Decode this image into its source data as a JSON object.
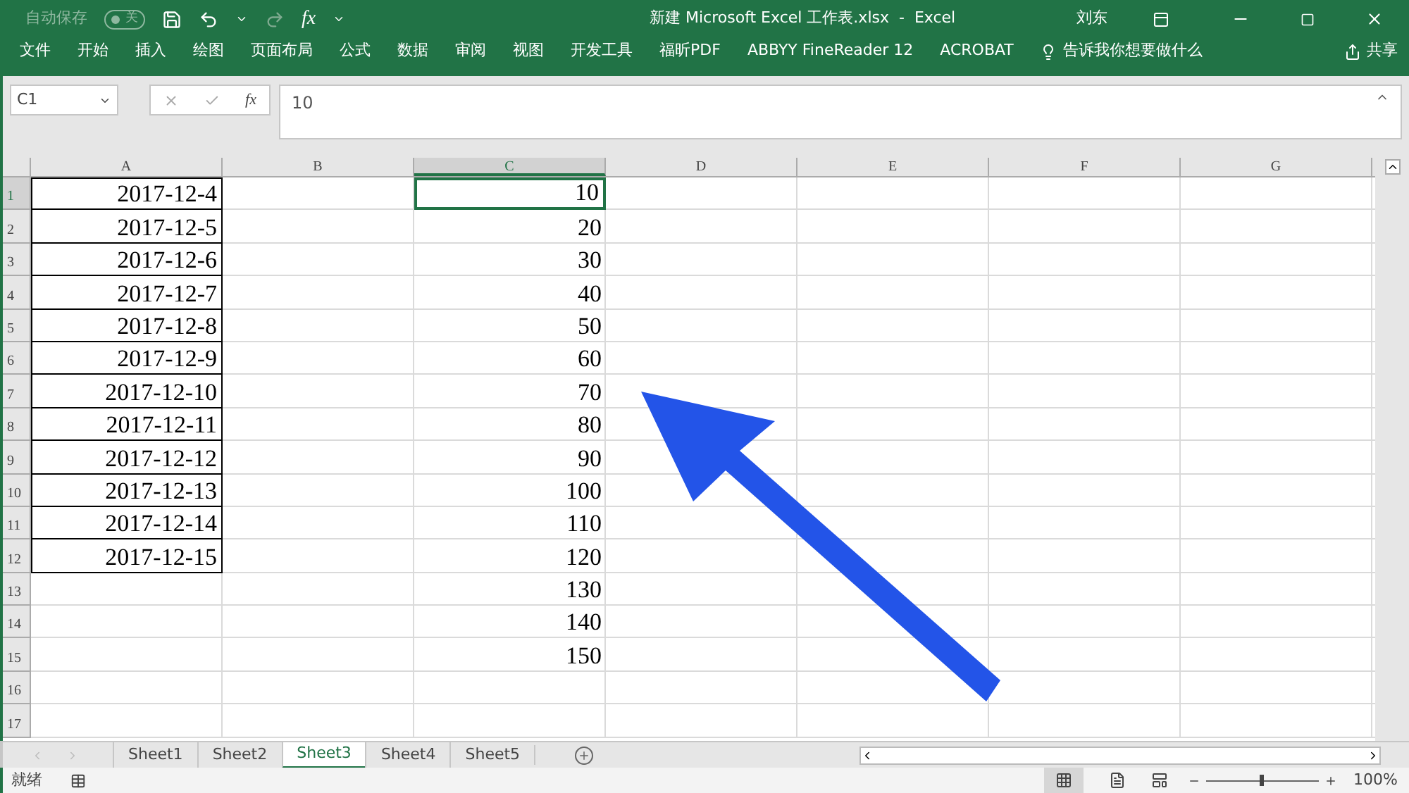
{
  "title_bar": {
    "autosave_label": "自动保存",
    "autosave_toggle": {
      "label": "关",
      "on": false
    },
    "title": "新建 Microsoft Excel 工作表.xlsx  -  Excel",
    "function_symbol": "fx",
    "user": "刘东"
  },
  "ribbon_tabs": [
    "文件",
    "开始",
    "插入",
    "绘图",
    "页面布局",
    "公式",
    "数据",
    "审阅",
    "视图",
    "开发工具",
    "福昕PDF",
    "ABBYY FineReader 12",
    "ACROBAT"
  ],
  "tell_me": "告诉我你想要做什么",
  "share": "共享",
  "formula_bar": {
    "name_box": "C1",
    "insert_function": "fx",
    "value": "10"
  },
  "columns": [
    {
      "label": "A",
      "selected": false
    },
    {
      "label": "B",
      "selected": false
    },
    {
      "label": "C",
      "selected": true
    },
    {
      "label": "D",
      "selected": false
    },
    {
      "label": "E",
      "selected": false
    },
    {
      "label": "F",
      "selected": false
    },
    {
      "label": "G",
      "selected": false
    }
  ],
  "rows": [
    {
      "label": "1",
      "selected": true,
      "a": "2017-12-4",
      "c": "10",
      "bordered": true
    },
    {
      "label": "2",
      "selected": false,
      "a": "2017-12-5",
      "c": "20",
      "bordered": true
    },
    {
      "label": "3",
      "selected": false,
      "a": "2017-12-6",
      "c": "30",
      "bordered": true
    },
    {
      "label": "4",
      "selected": false,
      "a": "2017-12-7",
      "c": "40",
      "bordered": true
    },
    {
      "label": "5",
      "selected": false,
      "a": "2017-12-8",
      "c": "50",
      "bordered": true
    },
    {
      "label": "6",
      "selected": false,
      "a": "2017-12-9",
      "c": "60",
      "bordered": true
    },
    {
      "label": "7",
      "selected": false,
      "a": "2017-12-10",
      "c": "70",
      "bordered": true
    },
    {
      "label": "8",
      "selected": false,
      "a": "2017-12-11",
      "c": "80",
      "bordered": true
    },
    {
      "label": "9",
      "selected": false,
      "a": "2017-12-12",
      "c": "90",
      "bordered": true
    },
    {
      "label": "10",
      "selected": false,
      "a": "2017-12-13",
      "c": "100",
      "bordered": true
    },
    {
      "label": "11",
      "selected": false,
      "a": "2017-12-14",
      "c": "110",
      "bordered": true
    },
    {
      "label": "12",
      "selected": false,
      "a": "2017-12-15",
      "c": "120",
      "bordered": true
    },
    {
      "label": "13",
      "selected": false,
      "c": "130",
      "bordered": false
    },
    {
      "label": "14",
      "selected": false,
      "c": "140",
      "bordered": false
    },
    {
      "label": "15",
      "selected": false,
      "c": "150",
      "bordered": false
    },
    {
      "label": "16",
      "selected": false,
      "bordered": false
    },
    {
      "label": "17",
      "selected": false,
      "bordered": false
    }
  ],
  "sheets": [
    {
      "label": "Sheet1",
      "selected": false
    },
    {
      "label": "Sheet2",
      "selected": false
    },
    {
      "label": "Sheet3",
      "selected": true
    },
    {
      "label": "Sheet4",
      "selected": false
    },
    {
      "label": "Sheet5",
      "selected": false
    }
  ],
  "status_bar": {
    "status": "就绪",
    "zoom_slider": {
      "level": 0.5
    },
    "zoom": "100%"
  }
}
